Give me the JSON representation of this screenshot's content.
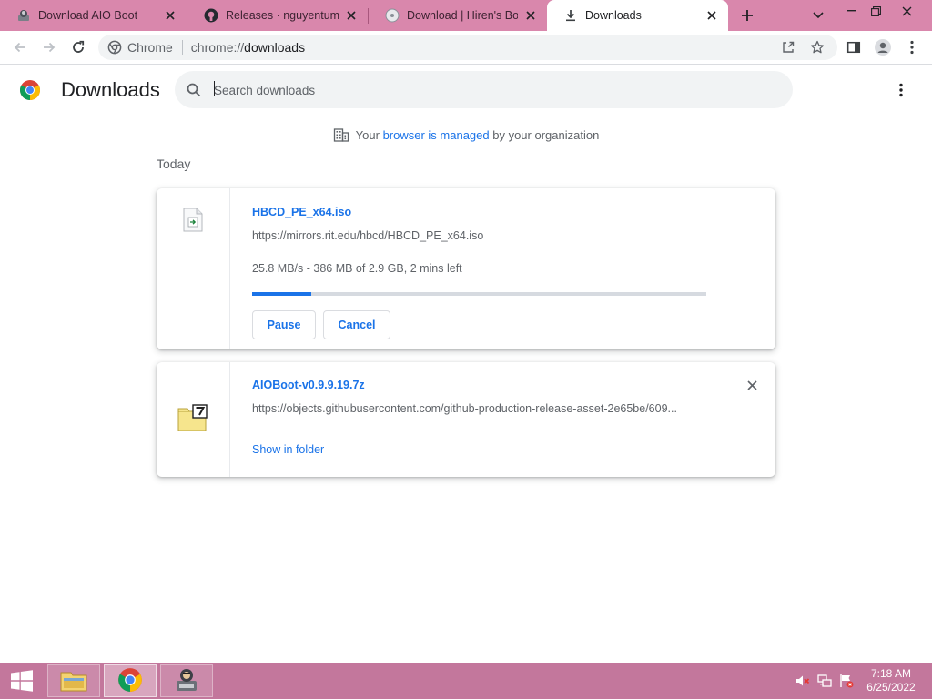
{
  "tabs": [
    {
      "title": "Download AIO Boot",
      "favicon": "aioboot-icon",
      "active": false
    },
    {
      "title": "Releases · nguyentumine",
      "favicon": "github-icon",
      "active": false
    },
    {
      "title": "Download | Hiren's Boot",
      "favicon": "disc-icon",
      "active": false
    },
    {
      "title": "Downloads",
      "favicon": "download-icon",
      "active": true
    }
  ],
  "toolbar": {
    "site_label": "Chrome",
    "url_scheme": "chrome://",
    "url_host": "downloads"
  },
  "header": {
    "title": "Downloads",
    "search_placeholder": "Search downloads"
  },
  "managed": {
    "prefix": "Your ",
    "link": "browser is managed",
    "suffix": " by your organization"
  },
  "section": {
    "title": "Today"
  },
  "downloads": [
    {
      "file_name": "HBCD_PE_x64.iso",
      "url": "https://mirrors.rit.edu/hbcd/HBCD_PE_x64.iso",
      "status": "25.8 MB/s - 386 MB of 2.9 GB, 2 mins left",
      "progress": 0.13,
      "pause_label": "Pause",
      "cancel_label": "Cancel",
      "icon": "iso-file-icon"
    },
    {
      "file_name": "AIOBoot-v0.9.9.19.7z",
      "url": "https://objects.githubusercontent.com/github-production-release-asset-2e65be/609...",
      "show_in_folder_label": "Show in folder",
      "icon": "7z-archive-icon"
    }
  ],
  "taskbar": {
    "time": "7:18 AM",
    "date": "6/25/2022"
  },
  "colors": {
    "tab_strip": "#d987ac",
    "taskbar": "#c3779c",
    "accent": "#1a73e8"
  }
}
